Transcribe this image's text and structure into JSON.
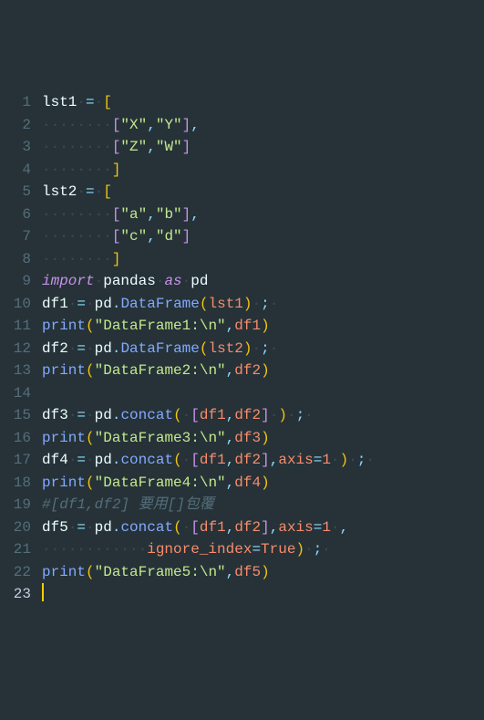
{
  "gutter": {
    "lines": [
      "1",
      "2",
      "3",
      "4",
      "5",
      "6",
      "7",
      "8",
      "9",
      "10",
      "11",
      "12",
      "13",
      "14",
      "15",
      "16",
      "17",
      "18",
      "19",
      "20",
      "21",
      "22",
      "23"
    ],
    "currentLine": 23
  },
  "code": {
    "l1": {
      "id": "lst1",
      "op": "=",
      "br": "["
    },
    "l2": {
      "br1": "[",
      "s1": "\"X\"",
      "c": ",",
      "s2": "\"Y\"",
      "br2": "]",
      "c2": ","
    },
    "l3": {
      "br1": "[",
      "s1": "\"Z\"",
      "c": ",",
      "s2": "\"W\"",
      "br2": "]"
    },
    "l4": {
      "br": "]"
    },
    "l5": {
      "id": "lst2",
      "op": "=",
      "br": "["
    },
    "l6": {
      "br1": "[",
      "s1": "\"a\"",
      "c": ",",
      "s2": "\"b\"",
      "br2": "]",
      "c2": ","
    },
    "l7": {
      "br1": "[",
      "s1": "\"c\"",
      "c": ",",
      "s2": "\"d\"",
      "br2": "]"
    },
    "l8": {
      "br": "]"
    },
    "l9": {
      "kw1": "import",
      "id1": "pandas",
      "kw2": "as",
      "id2": "pd"
    },
    "l10": {
      "id1": "df1",
      "op": "=",
      "id2": "pd",
      "dot": ".",
      "fn": "DataFrame",
      "p1": "(",
      "arg": "lst1",
      "p2": ")",
      "sc": ";"
    },
    "l11": {
      "fn": "print",
      "p1": "(",
      "s": "\"DataFrame1:\\n\"",
      "c": ",",
      "arg": "df1",
      "p2": ")"
    },
    "l12": {
      "id1": "df2",
      "op": "=",
      "id2": "pd",
      "dot": ".",
      "fn": "DataFrame",
      "p1": "(",
      "arg": "lst2",
      "p2": ")",
      "sc": ";"
    },
    "l13": {
      "fn": "print",
      "p1": "(",
      "s": "\"DataFrame2:\\n\"",
      "c": ",",
      "arg": "df2",
      "p2": ")"
    },
    "l15": {
      "id1": "df3",
      "op": "=",
      "id2": "pd",
      "dot": ".",
      "fn": "concat",
      "p1": "(",
      "br1": "[",
      "a1": "df1",
      "c": ",",
      "a2": "df2",
      "br2": "]",
      "p2": ")",
      "sc": ";"
    },
    "l16": {
      "fn": "print",
      "p1": "(",
      "s": "\"DataFrame3:\\n\"",
      "c": ",",
      "arg": "df3",
      "p2": ")"
    },
    "l17": {
      "id1": "df4",
      "op": "=",
      "id2": "pd",
      "dot": ".",
      "fn": "concat",
      "p1": "(",
      "br1": "[",
      "a1": "df1",
      "c": ",",
      "a2": "df2",
      "br2": "]",
      "c2": ",",
      "k": "axis",
      "eq": "=",
      "v": "1",
      "p2": ")",
      "sc": ";"
    },
    "l18": {
      "fn": "print",
      "p1": "(",
      "s": "\"DataFrame4:\\n\"",
      "c": ",",
      "arg": "df4",
      "p2": ")"
    },
    "l19": {
      "cm": "#[df1,df2] ",
      "cjk": "要用[]包覆"
    },
    "l20": {
      "id1": "df5",
      "op": "=",
      "id2": "pd",
      "dot": ".",
      "fn": "concat",
      "p1": "(",
      "br1": "[",
      "a1": "df1",
      "c": ",",
      "a2": "df2",
      "br2": "]",
      "c2": ",",
      "k": "axis",
      "eq": "=",
      "v": "1",
      "c3": ","
    },
    "l21": {
      "k": "ignore_index",
      "eq": "=",
      "v": "True",
      "p2": ")",
      "sc": ";"
    },
    "l22": {
      "fn": "print",
      "p1": "(",
      "s": "\"DataFrame5:\\n\"",
      "c": ",",
      "arg": "df5",
      "p2": ")"
    }
  },
  "ws": {
    "d4": "····",
    "d8": "········",
    "d1": "·",
    "d12": "············",
    "d16": "················"
  }
}
